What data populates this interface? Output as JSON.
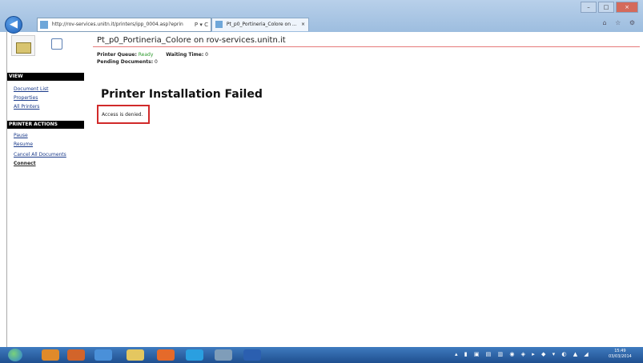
{
  "browser": {
    "address_url": "http://rov-services.unitn.it/printers/ipp_0004.asp?eprin",
    "address_controls": "P ▾ C",
    "tab_title": "Pt_p0_Portineria_Colore on ...",
    "tab_close": "×",
    "window_controls": [
      "–",
      "□",
      "×"
    ],
    "toolbar_icons": "⌂ ☆ ⚙"
  },
  "page": {
    "title": "Pt_p0_Portineria_Colore on rov-services.unitn.it",
    "status": {
      "printer_queue_label": "Printer Queue:",
      "printer_queue_value": "Ready",
      "waiting_time_label": "Waiting Time:",
      "waiting_time_value": "0",
      "pending_documents_label": "Pending Documents:",
      "pending_documents_value": "0"
    },
    "error_title": "Printer Installation Failed",
    "error_message": "Access is denied."
  },
  "sidebar": {
    "view_header": "VIEW",
    "view_links": [
      "Document List",
      "Properties",
      "All Printers"
    ],
    "actions_header": "PRINTER ACTIONS",
    "action_links": [
      "Pause",
      "Resume",
      "Cancel All Documents",
      "Connect"
    ]
  },
  "taskbar": {
    "tray_icons": "▴ ▮ ▣ ▤ ▥ ◉ ◈ ▸ ◆ ▾ ◐ ▲ ◢",
    "clock_time": "15:49",
    "clock_date": "03/03/2014"
  }
}
